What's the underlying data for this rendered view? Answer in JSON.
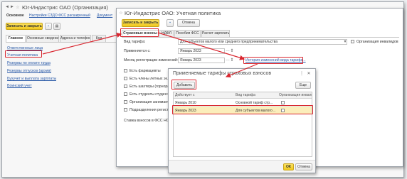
{
  "main_window": {
    "title": "Юг-Индастрис ОАО (Организация)",
    "nav_links": [
      "Основное",
      "Настройки СЗДО ФСС расширенный",
      "Документ"
    ],
    "save_close": "Записать и закрыть",
    "tabs": [
      "Главное",
      "Основные сведения",
      "Адреса и телефоны",
      "Код"
    ],
    "sidebar_links": [
      "Ответственные лица",
      "Учетная политика",
      "Резервы по оплате труда",
      "Резервы отпусков (архив)",
      "Бухучет и выплата зарплаты",
      "Воинский учет"
    ]
  },
  "policy_window": {
    "title": "Юг-Индастрис ОАО: Учетная политика",
    "save_close": "Записать и закрыть",
    "cancel": "Отмена",
    "tabs": [
      "Страховые взносы",
      "НДФЛ",
      "Пособия ФСС",
      "Расчет зарплаты"
    ],
    "tariff_type_label": "Вид тарифа:",
    "tariff_type_value": "Для субъектов малого или среднего предпринимательства",
    "disabled_org_label": "Организация инвалидов",
    "applied_from_label": "Применяется с:",
    "applied_from_value": "Январь 2023",
    "change_month_label": "Месяц регистрации изменений:",
    "change_month_value": "Январь 2023",
    "history_link": "История изменений вида тарифа...",
    "checkboxes": [
      "Есть фармацевты",
      "Есть члены летных эк...",
      "Есть шахтеры (горнора...",
      "Есть студенты студенч...",
      "Организация занимает...",
      "Подразделения регистр..."
    ],
    "fss_rate_label": "Ставка взносов в ФСС НС"
  },
  "dialog": {
    "title": "Применяемые тарифы страховых взносов",
    "add_button": "Добавить",
    "more_button": "Еще",
    "columns": [
      "Действует с",
      "Вид тарифа",
      "Организация инвалид"
    ],
    "rows": [
      {
        "from": "Январь 2010",
        "type": "Основной тариф стр..."
      },
      {
        "from": "Январь 2023",
        "type": "Для субъектов малого ..."
      }
    ],
    "ok_button": "ОК",
    "cancel_button": "Отмена"
  },
  "colors": {
    "accent_yellow": "#f0c81e",
    "highlight_red": "#d9262f",
    "selected_row": "#fbeebb",
    "link_blue": "#2a5aa8"
  }
}
